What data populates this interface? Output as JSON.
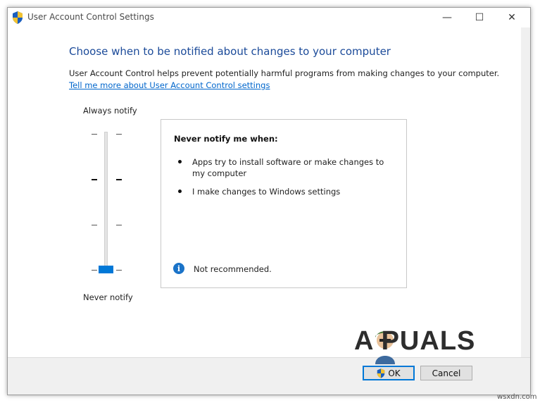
{
  "window": {
    "title": "User Account Control Settings",
    "controls": {
      "minimize": "—",
      "maximize": "☐",
      "close": "✕"
    }
  },
  "main": {
    "heading": "Choose when to be notified about changes to your computer",
    "description": "User Account Control helps prevent potentially harmful programs from making changes to your computer.",
    "learn_more_link": "Tell me more about User Account Control settings"
  },
  "slider": {
    "top_label": "Always notify",
    "bottom_label": "Never notify",
    "levels": 4,
    "selected_level": 1,
    "accent_color": "#0078d7"
  },
  "info_box": {
    "heading": "Never notify me when:",
    "bullets": [
      "Apps try to install software or make changes to my computer",
      "I make changes to Windows settings"
    ],
    "note": "Not recommended.",
    "note_icon": "info-icon"
  },
  "footer": {
    "ok_label": "OK",
    "cancel_label": "Cancel",
    "ok_icon": "shield-icon"
  },
  "overlay": {
    "watermark": "A  PUALS",
    "site": "wsxdn.com"
  },
  "colors": {
    "heading": "#1b4a99",
    "link": "#0066cc",
    "info": "#1a73c8"
  }
}
